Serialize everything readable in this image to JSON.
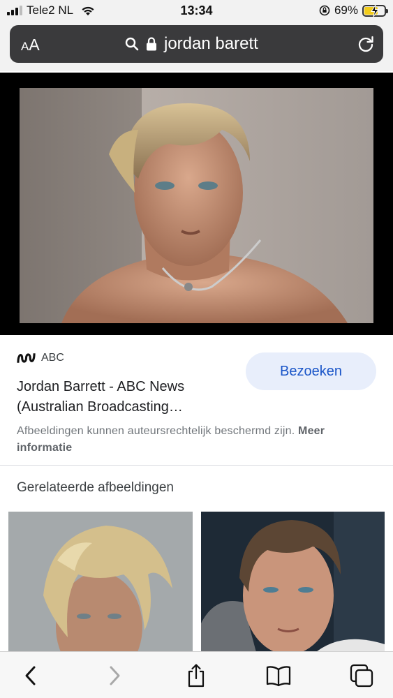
{
  "status_bar": {
    "carrier": "Tele2 NL",
    "time": "13:34",
    "battery_percent": "69%",
    "battery_level": 0.69,
    "battery_color": "#f2cc1a",
    "icons": [
      "signal-icon",
      "wifi-icon",
      "rotation-lock-icon",
      "battery-icon",
      "charging-bolt-icon"
    ]
  },
  "address_bar": {
    "text_size_label_small": "A",
    "text_size_label_large": "A",
    "url_text": "jordan barett",
    "icons": [
      "search-icon",
      "lock-icon",
      "reload-icon"
    ]
  },
  "result": {
    "source_name": "ABC",
    "source_logo": "abc-logo-icon",
    "title": "Jordan Barrett - ABC News (Australian Broadcasting…",
    "visit_button": "Bezoeken",
    "copyright_text": "Afbeeldingen kunnen auteursrechtelijk beschermd zijn.",
    "more_info_link": "Meer informatie",
    "accent_color": "#1a55c8"
  },
  "related": {
    "heading": "Gerelateerde afbeeldingen"
  },
  "toolbar": {
    "icons": [
      "back-icon",
      "forward-icon",
      "share-icon",
      "bookmarks-icon",
      "tabs-icon"
    ]
  }
}
